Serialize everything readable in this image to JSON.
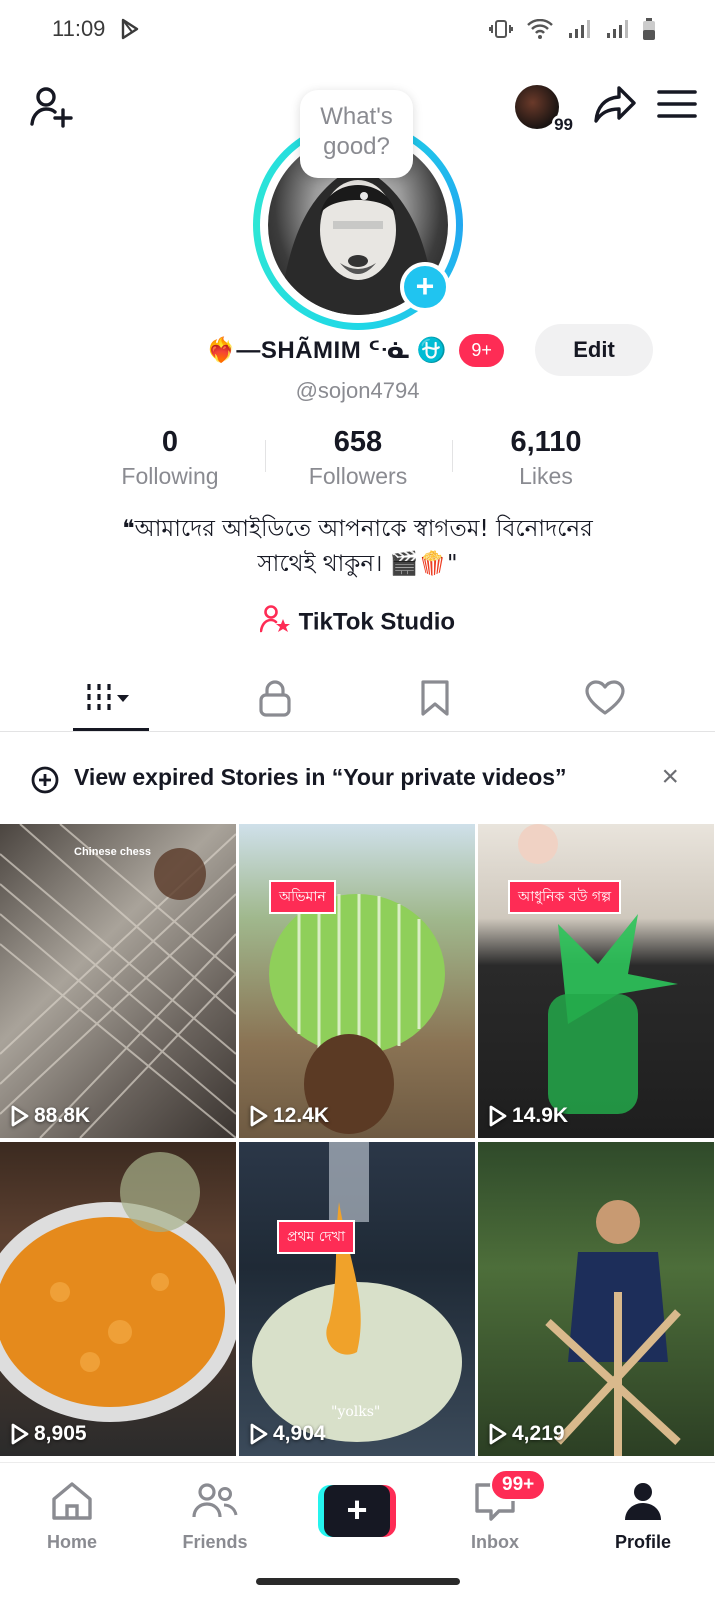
{
  "status_bar": {
    "time": "11:09"
  },
  "header": {
    "mini_avatar_badge": "99"
  },
  "profile": {
    "bubble_text_line1": "What's",
    "bubble_text_line2": "good?",
    "display_name": "❤️‍🔥—SHÃMIM ᑦᓍ ⛎",
    "notification_badge": "9+",
    "edit_label": "Edit",
    "username": "@sojon4794"
  },
  "stats": [
    {
      "value": "0",
      "label": "Following"
    },
    {
      "value": "658",
      "label": "Followers"
    },
    {
      "value": "6,110",
      "label": "Likes"
    }
  ],
  "bio": {
    "line1": "❝আমাদের আইডিতে  আপনাকে স্বাগতম! বিনোদনের",
    "line2": "সাথেই থাকুন। 🎬🍿\""
  },
  "studio_label": "TikTok Studio",
  "banner": {
    "text": "View expired Stories in “Your private videos”"
  },
  "videos": [
    {
      "views": "88.8K",
      "caption": "Chinese chess"
    },
    {
      "views": "12.4K",
      "tag": "অভিমান"
    },
    {
      "views": "14.9K",
      "tag": "আধুনিক বউ গল্প"
    },
    {
      "views": "8,905"
    },
    {
      "views": "4,904",
      "tag": "প্রথম দেখা",
      "caption": "\"yolks\""
    },
    {
      "views": "4,219"
    }
  ],
  "nav": {
    "home": "Home",
    "friends": "Friends",
    "inbox": "Inbox",
    "inbox_badge": "99+",
    "profile": "Profile"
  },
  "colors": {
    "accent": "#fe2c55",
    "cyan": "#25f4ee",
    "ring": "#1fd8e6",
    "text": "#161823",
    "muted": "#8a8b91"
  }
}
